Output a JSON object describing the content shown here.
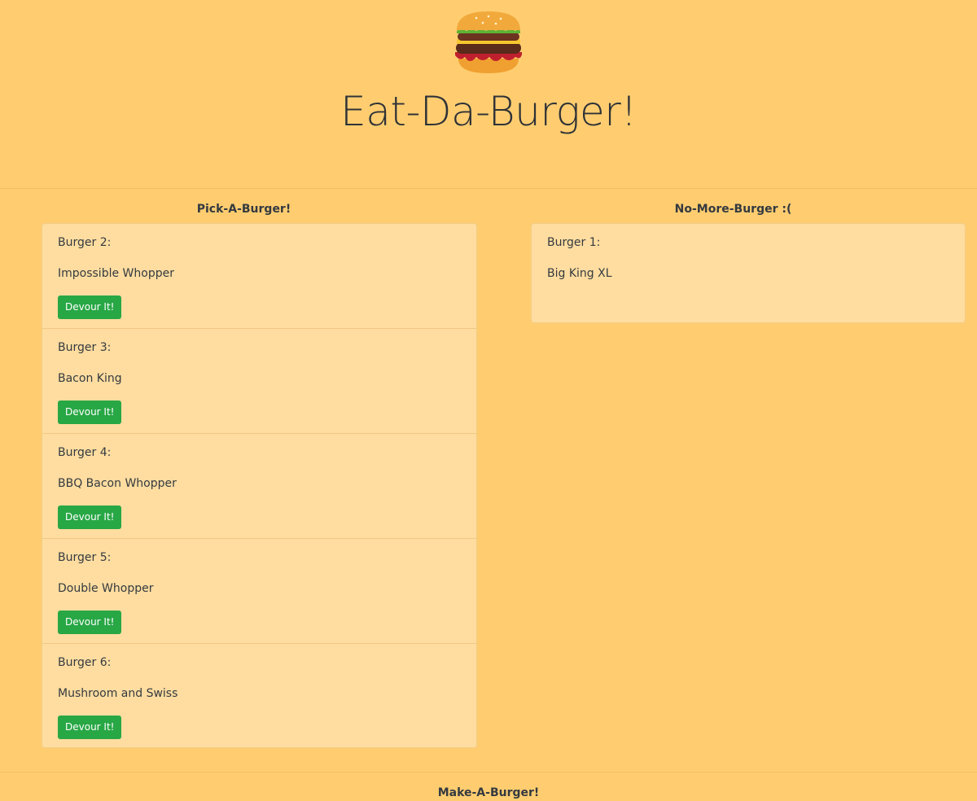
{
  "header": {
    "title": "Eat-Da-Burger!",
    "logo_icon": "burger-icon"
  },
  "left": {
    "title": "Pick-A-Burger!",
    "items": [
      {
        "num": "Burger 2:",
        "name": "Impossible Whopper",
        "button": "Devour It!"
      },
      {
        "num": "Burger 3:",
        "name": "Bacon King",
        "button": "Devour It!"
      },
      {
        "num": "Burger 4:",
        "name": "BBQ Bacon Whopper",
        "button": "Devour It!"
      },
      {
        "num": "Burger 5:",
        "name": "Double Whopper",
        "button": "Devour It!"
      },
      {
        "num": "Burger 6:",
        "name": "Mushroom and Swiss",
        "button": "Devour It!"
      }
    ]
  },
  "right": {
    "title": "No-More-Burger :(",
    "items": [
      {
        "num": "Burger 1:",
        "name": "Big King XL"
      }
    ]
  },
  "footer": {
    "title": "Make-A-Burger!"
  },
  "colors": {
    "background": "#ffcd70",
    "card": "#ffdda0",
    "button": "#28a745"
  }
}
